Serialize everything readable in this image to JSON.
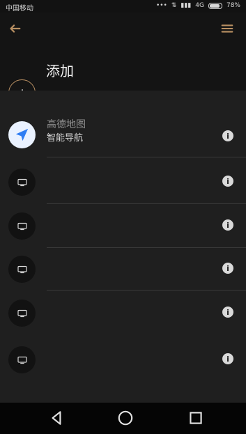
{
  "status_bar": {
    "carrier": "中国移动",
    "network": "4G",
    "battery": "78%"
  },
  "header": {
    "title": "添加",
    "back_icon": "arrow-left-icon",
    "menu_icon": "menu-icon"
  },
  "list": {
    "items": [
      {
        "title": "高德地图",
        "subtitle": "智能导航",
        "icon": "navigation-icon"
      },
      {
        "title": "",
        "subtitle": "",
        "icon": "device-icon"
      },
      {
        "title": "",
        "subtitle": "",
        "icon": "device-icon"
      },
      {
        "title": "",
        "subtitle": "",
        "icon": "device-icon"
      },
      {
        "title": "",
        "subtitle": "",
        "icon": "device-icon"
      },
      {
        "title": "",
        "subtitle": "",
        "icon": "device-icon"
      }
    ]
  },
  "navigation": {
    "back": "back-triangle-icon",
    "home": "home-circle-icon",
    "recent": "recent-square-icon"
  },
  "colors": {
    "accent": "#b88f62",
    "background": "#1f1f1f",
    "header_bg": "#141414",
    "navbar_bg": "#050505"
  }
}
